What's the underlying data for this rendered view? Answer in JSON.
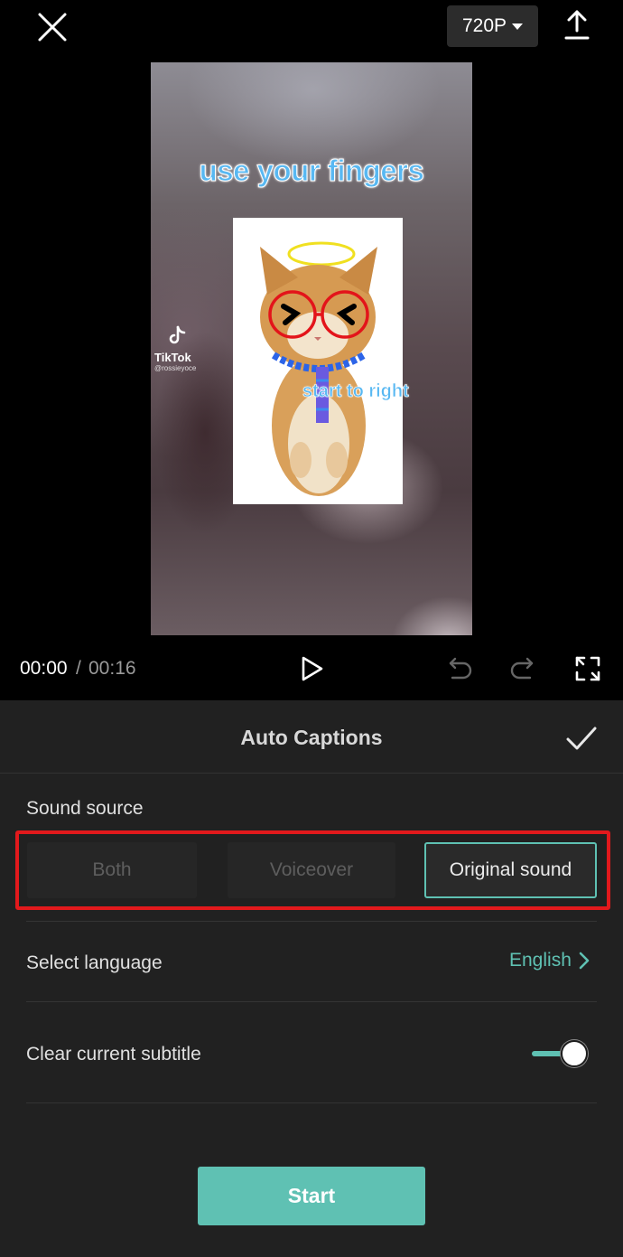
{
  "header": {
    "close_icon": "close-icon",
    "resolution": "720P",
    "export_icon": "upload-icon"
  },
  "preview": {
    "caption_top": "use your fingers",
    "caption_mid": "start to right",
    "watermark_brand": "TikTok",
    "watermark_handle": "@rossieyoce"
  },
  "playback": {
    "current_time": "00:00",
    "separator": "/",
    "total_time": "00:16",
    "play_icon": "play-icon",
    "undo_icon": "undo-icon",
    "redo_icon": "redo-icon",
    "fullscreen_icon": "fullscreen-icon"
  },
  "panel": {
    "title": "Auto Captions",
    "confirm_icon": "checkmark-icon",
    "sound_source": {
      "label": "Sound source",
      "options": [
        "Both",
        "Voiceover",
        "Original sound"
      ],
      "selected": "Original sound"
    },
    "language": {
      "label": "Select language",
      "value": "English"
    },
    "clear_subtitle": {
      "label": "Clear current subtitle",
      "enabled": true
    },
    "start_label": "Start"
  },
  "colors": {
    "accent": "#5fc1b3",
    "highlight": "#e2191c",
    "panel_bg": "#212121"
  }
}
